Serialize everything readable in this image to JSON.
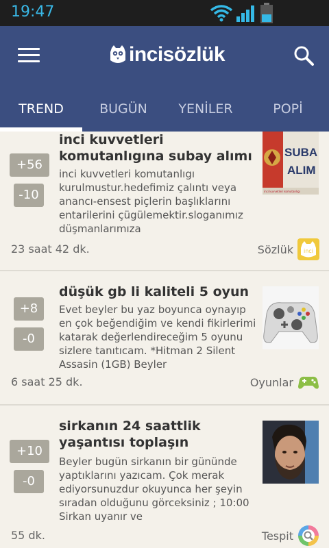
{
  "status_bar": {
    "time": "19:47"
  },
  "app": {
    "brand": "incisözlük"
  },
  "tabs": [
    {
      "label": "TREND"
    },
    {
      "label": "BUGÜN"
    },
    {
      "label": "YENİLER"
    },
    {
      "label": "POPİ"
    }
  ],
  "posts": [
    {
      "title": "inci kuvvetleri komutanlıgına subay alımı",
      "excerpt": "inci kuvvetleri komutanlıgı kurulmustur.hedefimiz çalıntı veya anancı-ensest piçlerin başlıklarını entarilerini çügülemektir.sloganımız düşmanlarımıza",
      "upvotes": "+56",
      "downvotes": "-10",
      "time": "23 saat 42 dk.",
      "channel": "Sözlük",
      "thumb_text": "SUBA ALIM",
      "thumb_caption": "inci kuvvetleri komutanlıgı"
    },
    {
      "title": "düşük gb li kaliteli 5 oyun",
      "excerpt": "Evet beyler bu yaz boyunca oynayıp en çok beğendiğim ve kendi fikirlerimi katarak değerlendireceğim 5 oyunu sizlere tanıtıcam. *Hitman 2 Silent Assasin (1GB) Beyler",
      "upvotes": "+8",
      "downvotes": "-0",
      "time": "6 saat 25 dk.",
      "channel": "Oyunlar"
    },
    {
      "title": "sirkanın 24 saattlik yaşantısı toplaşın",
      "excerpt": "Beyler bugün sirkanın bir gününde yaptıklarını yazıcam. Çok merak ediyorsunuzdur okuyunca her şeyin sıradan olduğunu görceksiniz ; 10:00 Sirkan uyanır ve",
      "upvotes": "+10",
      "downvotes": "-0",
      "time": "55 dk.",
      "channel": "Tespit"
    }
  ],
  "colors": {
    "appbar": "#3b4e80",
    "background": "#f4f1ea",
    "vote_badge": "#aaa79c",
    "status_accent": "#35b9e6"
  },
  "icons": {
    "menu": "hamburger-icon",
    "search": "search-icon",
    "sozluk": "inci-owl-icon",
    "oyunlar": "gamepad-icon",
    "tespit": "tespit-icon"
  }
}
